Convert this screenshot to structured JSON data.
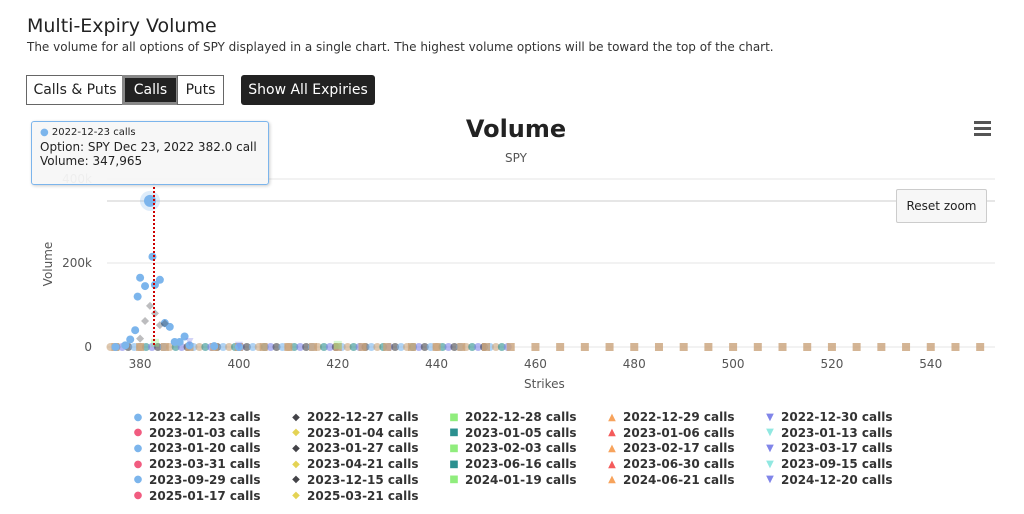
{
  "header": {
    "title": "Multi-Expiry Volume",
    "subtitle": "The volume for all options of SPY displayed in a single chart. The highest volume options will be toward the top of the chart."
  },
  "buttons": {
    "calls_puts": "Calls & Puts",
    "calls": "Calls",
    "puts": "Puts",
    "show_all": "Show All Expiries",
    "reset_zoom": "Reset zoom"
  },
  "tooltip": {
    "series": "2022-12-23 calls",
    "option": "Option: SPY Dec 23, 2022 382.0 call",
    "volume": "Volume: 347,965"
  },
  "chart_data": {
    "type": "scatter",
    "title": "Volume",
    "subtitle": "SPY",
    "xlabel": "Strikes",
    "ylabel": "Volume",
    "xlim": [
      373.3,
      553
    ],
    "ylim": [
      0,
      420000
    ],
    "xticks": [
      "380",
      "400",
      "420",
      "440",
      "460",
      "480",
      "500",
      "520",
      "540"
    ],
    "yticks": [
      "0",
      "200k",
      "400k"
    ],
    "legend_position": "bottom",
    "series": [
      {
        "name": "2022-12-23 calls",
        "color": "#7cb5ec",
        "marker": "circle",
        "points": [
          [
            375,
            0
          ],
          [
            377,
            4000
          ],
          [
            378,
            18000
          ],
          [
            379,
            40000
          ],
          [
            379.5,
            120000
          ],
          [
            380,
            165000
          ],
          [
            381,
            145000
          ],
          [
            382,
            347965
          ],
          [
            382.5,
            215000
          ],
          [
            383,
            148000
          ],
          [
            384,
            160000
          ],
          [
            385,
            57000
          ],
          [
            386,
            48000
          ],
          [
            387,
            12000
          ],
          [
            388,
            12000
          ],
          [
            389,
            25000
          ],
          [
            390,
            4000
          ],
          [
            395,
            2000
          ],
          [
            400,
            0
          ]
        ]
      },
      {
        "name": "2022-12-27 calls",
        "color": "#434348",
        "marker": "diamond",
        "points": [
          [
            380,
            20000
          ],
          [
            381,
            62000
          ],
          [
            382,
            98000
          ],
          [
            383,
            80000
          ],
          [
            384,
            52000
          ],
          [
            385,
            56000
          ]
        ]
      },
      {
        "name": "2022-12-28 calls",
        "color": "#90ed7d",
        "marker": "square",
        "points": [
          [
            420,
            5000
          ],
          [
            383,
            10000
          ]
        ]
      },
      {
        "name": "2022-12-29 calls",
        "color": "#f7a35c",
        "marker": "triangle",
        "points": []
      },
      {
        "name": "2022-12-30 calls",
        "color": "#8085e9",
        "marker": "triangle-down",
        "points": [
          [
            390,
            12000
          ],
          [
            400,
            3000
          ]
        ]
      },
      {
        "name": "2023-01-03 calls",
        "color": "#f15c80",
        "marker": "circle",
        "points": []
      },
      {
        "name": "2023-01-04 calls",
        "color": "#e4d354",
        "marker": "diamond",
        "points": []
      },
      {
        "name": "2023-01-05 calls",
        "color": "#2b908f",
        "marker": "square",
        "points": []
      },
      {
        "name": "2023-01-06 calls",
        "color": "#f45b5b",
        "marker": "triangle",
        "points": []
      },
      {
        "name": "2023-01-13 calls",
        "color": "#91e8e1",
        "marker": "triangle-down",
        "points": []
      },
      {
        "name": "2023-01-20 calls",
        "color": "#7cb5ec",
        "marker": "circle",
        "points": []
      },
      {
        "name": "2023-01-27 calls",
        "color": "#434348",
        "marker": "diamond",
        "points": []
      },
      {
        "name": "2023-02-03 calls",
        "color": "#90ed7d",
        "marker": "square",
        "points": []
      },
      {
        "name": "2023-02-17 calls",
        "color": "#f7a35c",
        "marker": "triangle",
        "points": []
      },
      {
        "name": "2023-03-17 calls",
        "color": "#8085e9",
        "marker": "triangle-down",
        "points": []
      },
      {
        "name": "2023-03-31 calls",
        "color": "#f15c80",
        "marker": "circle",
        "points": []
      },
      {
        "name": "2023-04-21 calls",
        "color": "#e4d354",
        "marker": "diamond",
        "points": []
      },
      {
        "name": "2023-06-16 calls",
        "color": "#2b908f",
        "marker": "square",
        "points": []
      },
      {
        "name": "2023-06-30 calls",
        "color": "#f45b5b",
        "marker": "triangle",
        "points": []
      },
      {
        "name": "2023-09-15 calls",
        "color": "#91e8e1",
        "marker": "triangle-down",
        "points": []
      },
      {
        "name": "2023-09-29 calls",
        "color": "#7cb5ec",
        "marker": "circle",
        "points": []
      },
      {
        "name": "2023-12-15 calls",
        "color": "#434348",
        "marker": "diamond",
        "points": []
      },
      {
        "name": "2024-01-19 calls",
        "color": "#90ed7d",
        "marker": "square",
        "points": []
      },
      {
        "name": "2024-06-21 calls",
        "color": "#f7a35c",
        "marker": "triangle",
        "points": []
      },
      {
        "name": "2024-12-20 calls",
        "color": "#8085e9",
        "marker": "triangle-down",
        "points": []
      },
      {
        "name": "2025-01-17 calls",
        "color": "#f15c80",
        "marker": "circle",
        "points": []
      },
      {
        "name": "2025-03-21 calls",
        "color": "#e4d354",
        "marker": "diamond",
        "points": []
      }
    ]
  }
}
